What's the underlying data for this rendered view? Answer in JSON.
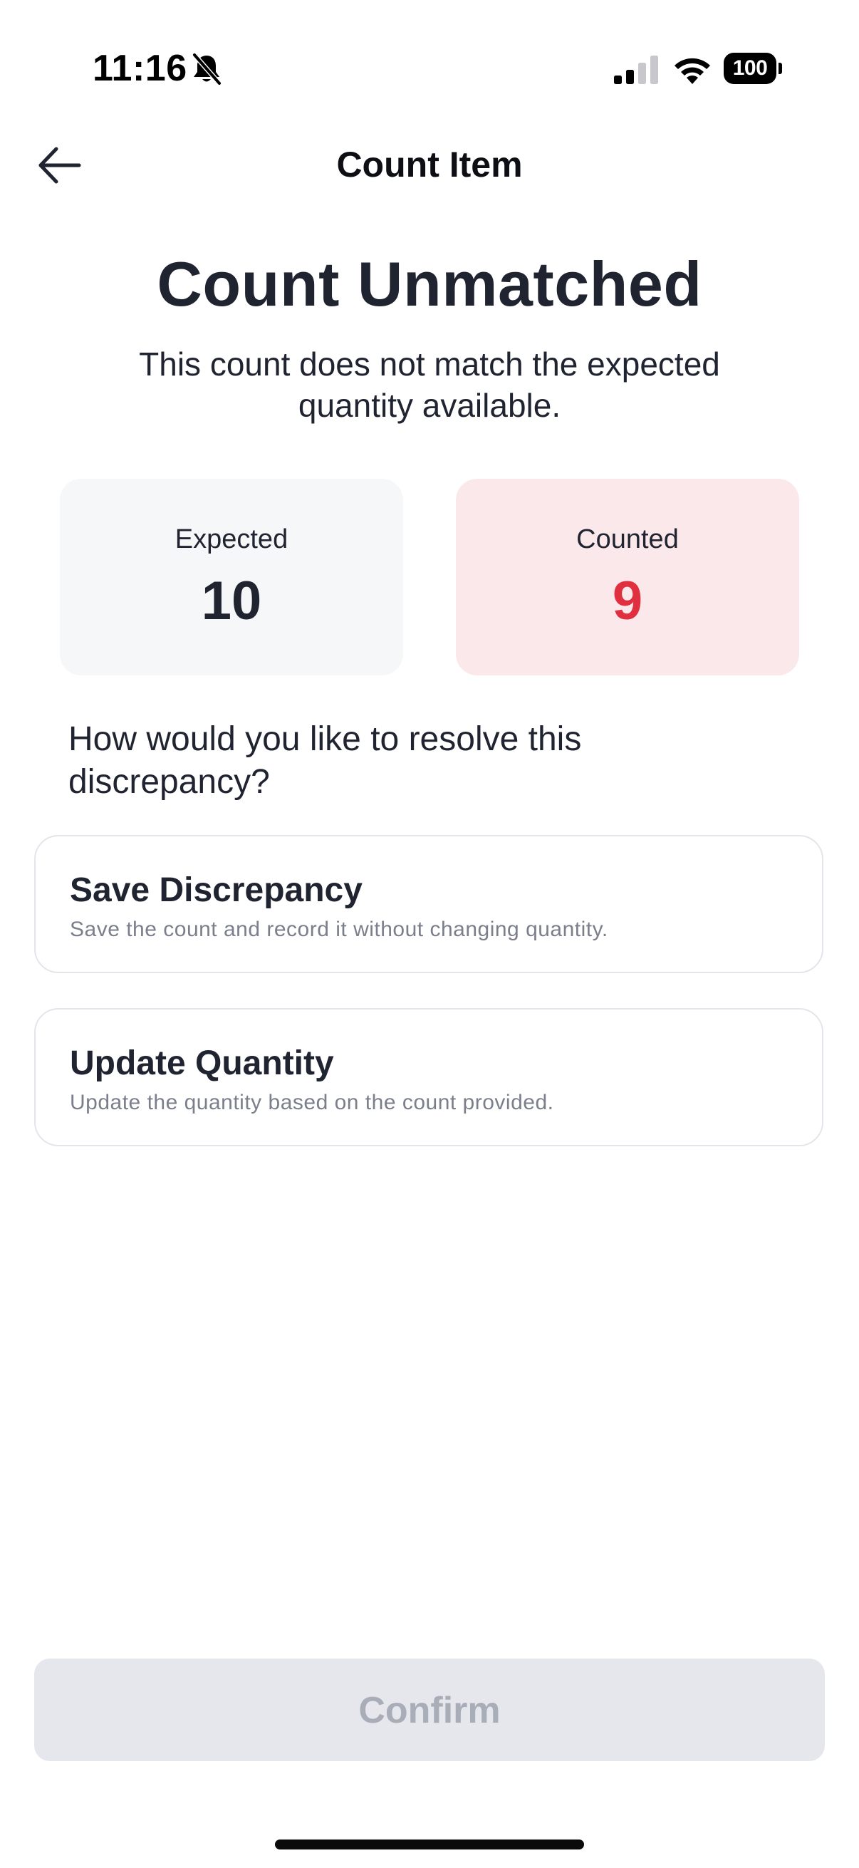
{
  "status_bar": {
    "time": "11:16",
    "battery": "100",
    "icons": [
      "bell-slash-icon",
      "cellular-signal-icon",
      "wifi-icon",
      "battery-icon"
    ]
  },
  "nav": {
    "title": "Count Item",
    "back_icon": "arrow-left-icon"
  },
  "main": {
    "heading": "Count Unmatched",
    "subtitle": "This count does not match the expected quantity available.",
    "expected": {
      "label": "Expected",
      "value": "10"
    },
    "counted": {
      "label": "Counted",
      "value": "9"
    },
    "question": "How would you like to resolve this discrepancy?",
    "options": [
      {
        "title": "Save Discrepancy",
        "description": "Save the count and record it without changing quantity."
      },
      {
        "title": "Update Quantity",
        "description": "Update the quantity based on the count provided."
      }
    ]
  },
  "footer": {
    "confirm_label": "Confirm"
  },
  "colors": {
    "counted_accent": "#e0303f",
    "counted_background": "#fbe8ea",
    "expected_background": "#f6f7f9",
    "disabled_button": "#e5e7ed"
  }
}
